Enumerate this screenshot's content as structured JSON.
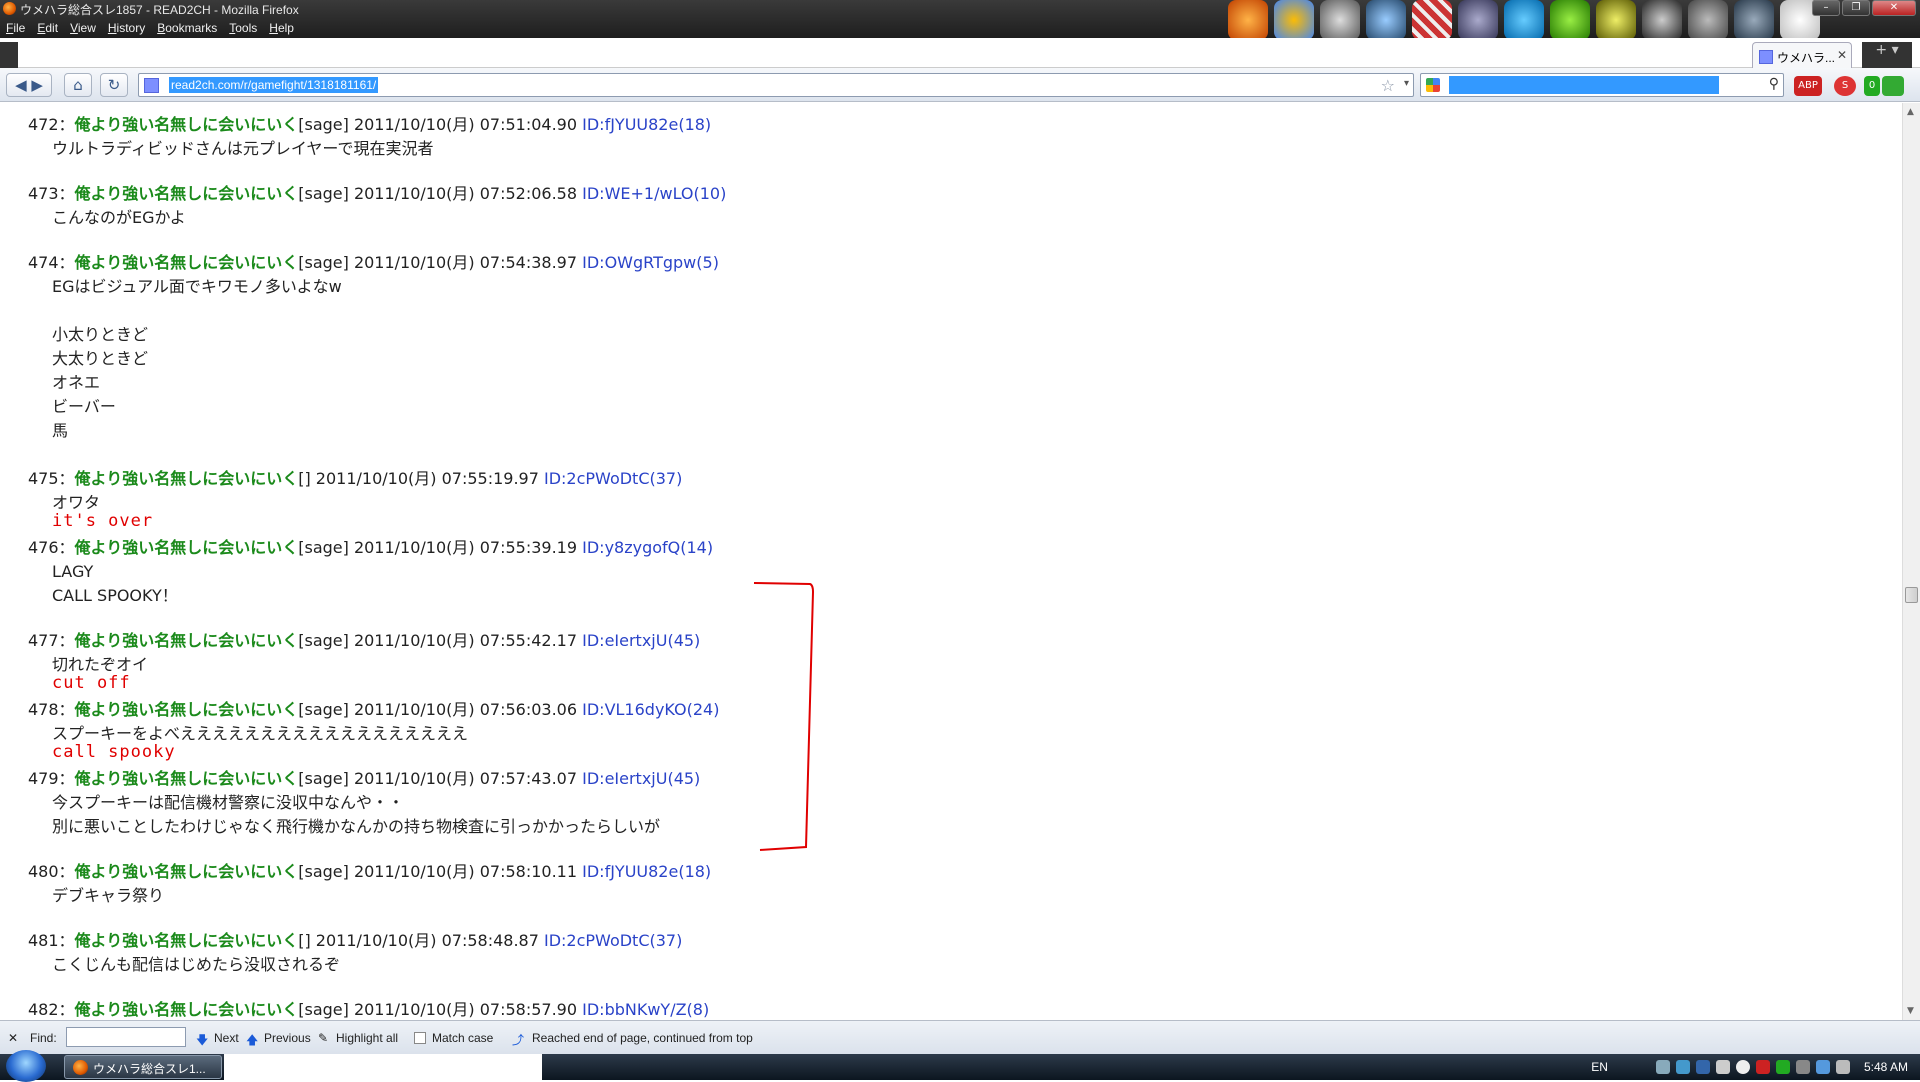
{
  "window": {
    "title": "ウメハラ総合スレ1857 - READ2CH - Mozilla Firefox"
  },
  "menu": [
    "File",
    "Edit",
    "View",
    "History",
    "Bookmarks",
    "Tools",
    "Help"
  ],
  "tab": {
    "label": "ウメハラ..."
  },
  "nav": {
    "url": "read2ch.com/r/gamefight/1318181161/"
  },
  "posts": [
    {
      "num": "472：",
      "name": "俺より強い名無しに会いにいく",
      "meta": "[sage] 2011/10/10(月) 07:51:04.90",
      "id": "ID:fJYUU82e(18)",
      "lines": [
        "ウルトラディビッドさんは元プレイヤーで現在実況者"
      ]
    },
    {
      "num": "473：",
      "name": "俺より強い名無しに会いにいく",
      "meta": "[sage] 2011/10/10(月) 07:52:06.58",
      "id": "ID:WE+1/wLO(10)",
      "lines": [
        "こんなのがEGかよ"
      ]
    },
    {
      "num": "474：",
      "name": "俺より強い名無しに会いにいく",
      "meta": "[sage] 2011/10/10(月) 07:54:38.97",
      "id": "ID:OWgRTgpw(5)",
      "lines": [
        "EGはビジュアル面でキワモノ多いよなw",
        "",
        "小太りときど",
        "大太りときど",
        "オネエ",
        "ビーバー",
        "馬"
      ]
    },
    {
      "num": "475：",
      "name": "俺より強い名無しに会いにいく",
      "meta": "[] 2011/10/10(月) 07:55:19.97",
      "id": "ID:2cPWoDtC(37)",
      "lines": [
        "オワタ"
      ]
    },
    {
      "num": "476：",
      "name": "俺より強い名無しに会いにいく",
      "meta": "[sage] 2011/10/10(月) 07:55:39.19",
      "id": "ID:y8zygofQ(14)",
      "lines": [
        "LAGY",
        "CALL SPOOKY！"
      ]
    },
    {
      "num": "477：",
      "name": "俺より強い名無しに会いにいく",
      "meta": "[sage] 2011/10/10(月) 07:55:42.17",
      "id": "ID:eIertxjU(45)",
      "lines": [
        "切れたぞオイ"
      ]
    },
    {
      "num": "478：",
      "name": "俺より強い名無しに会いにいく",
      "meta": "[sage] 2011/10/10(月) 07:56:03.06",
      "id": "ID:VL16dyKO(24)",
      "lines": [
        "スプーキーをよべええええええええええええええええええ"
      ]
    },
    {
      "num": "479：",
      "name": "俺より強い名無しに会いにいく",
      "meta": "[sage] 2011/10/10(月) 07:57:43.07",
      "id": "ID:eIertxjU(45)",
      "lines": [
        "今スプーキーは配信機材警察に没収中なんや・・",
        "別に悪いことしたわけじゃなく飛行機かなんかの持ち物検査に引っかかったらしいが"
      ]
    },
    {
      "num": "480：",
      "name": "俺より強い名無しに会いにいく",
      "meta": "[sage] 2011/10/10(月) 07:58:10.11",
      "id": "ID:fJYUU82e(18)",
      "lines": [
        "デブキャラ祭り"
      ]
    },
    {
      "num": "481：",
      "name": "俺より強い名無しに会いにいく",
      "meta": "[] 2011/10/10(月) 07:58:48.87",
      "id": "ID:2cPWoDtC(37)",
      "lines": [
        "こくじんも配信はじめたら没収されるぞ"
      ]
    },
    {
      "num": "482：",
      "name": "俺より強い名無しに会いにいく",
      "meta": "[sage] 2011/10/10(月) 07:58:57.90",
      "id": "ID:bbNKwY/Z(8)",
      "lines": []
    }
  ],
  "annotations": [
    "it's over",
    "cut off",
    "call spooky"
  ],
  "findbar": {
    "label": "Find:",
    "next": "Next",
    "previous": "Previous",
    "highlight": "Highlight all",
    "matchcase": "Match case",
    "status": "Reached end of page, continued from top"
  },
  "taskbar": {
    "button": "ウメハラ総合スレ1...",
    "lang": "EN",
    "time": "5:48 AM"
  },
  "colors": {
    "name": "#1b8a1b",
    "id": "#2a43c8",
    "annotation": "#e00000"
  }
}
